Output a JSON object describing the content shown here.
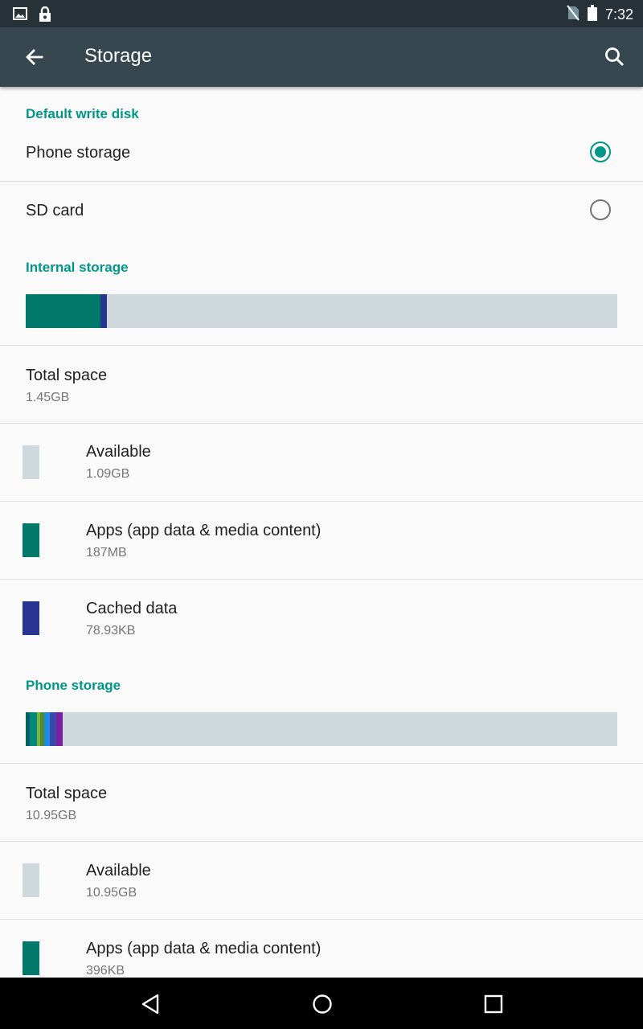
{
  "status_bar": {
    "time": "7:32"
  },
  "app_bar": {
    "title": "Storage"
  },
  "default_write_disk": {
    "header": "Default write disk",
    "options": [
      {
        "label": "Phone storage",
        "selected": true
      },
      {
        "label": "SD card",
        "selected": false
      }
    ]
  },
  "internal_storage": {
    "header": "Internal storage",
    "total_label": "Total space",
    "total_value": "1.45GB",
    "items": [
      {
        "label": "Available",
        "value": "1.09GB",
        "color": "#cfd8dc"
      },
      {
        "label": "Apps (app data & media content)",
        "value": "187MB",
        "color": "#00796b"
      },
      {
        "label": "Cached data",
        "value": "78.93KB",
        "color": "#283593"
      }
    ]
  },
  "phone_storage": {
    "header": "Phone storage",
    "total_label": "Total space",
    "total_value": "10.95GB",
    "items": [
      {
        "label": "Available",
        "value": "10.95GB",
        "color": "#cfd8dc"
      },
      {
        "label": "Apps (app data & media content)",
        "value": "396KB",
        "color": "#00796b"
      }
    ]
  },
  "colors": {
    "accent": "#009688",
    "app_bar": "#37474f",
    "status_bar": "#263238",
    "bar_background": "#cfd8dc"
  },
  "icons": [
    "image-icon",
    "lock-icon",
    "no-sim-icon",
    "battery-icon",
    "back-arrow-icon",
    "search-icon",
    "nav-back-icon",
    "nav-home-icon",
    "nav-recents-icon"
  ]
}
